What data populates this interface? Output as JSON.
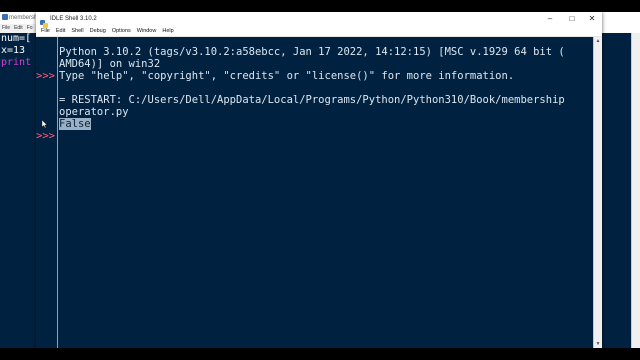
{
  "background_left_window": {
    "title": "membership",
    "menu": [
      "File",
      "Edit",
      "Fo"
    ],
    "code_lines": [
      {
        "text": "num=[",
        "color": "#ffffff"
      },
      {
        "text": "x=13",
        "color": "#ffffff"
      },
      {
        "text": "print",
        "color": "#d040d0"
      }
    ]
  },
  "shell_window": {
    "title": "IDLE Shell 3.10.2",
    "controls": {
      "minimize": "–",
      "maximize": "□",
      "close": "✕"
    },
    "menu": [
      "File",
      "Edit",
      "Shell",
      "Debug",
      "Options",
      "Window",
      "Help"
    ],
    "prompt": ">>>",
    "lines": {
      "l1": "Python 3.10.2 (tags/v3.10.2:a58ebcc, Jan 17 2022, 14:12:15) [MSC v.1929 64 bit (",
      "l2": "AMD64)] on win32",
      "l3": "Type \"help\", \"copyright\", \"credits\" or \"license()\" for more information.",
      "l4": "= RESTART: C:/Users/Dell/AppData/Local/Programs/Python/Python310/Book/membership",
      "l5": "operator.py",
      "l6": "False"
    }
  },
  "colors": {
    "shell_bg": "#002240",
    "prompt": "#ff5b77",
    "text": "#dbe6f0",
    "selection": "#9ab0c6"
  }
}
